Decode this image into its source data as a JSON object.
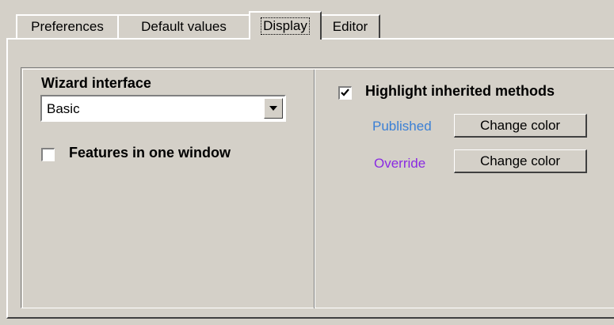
{
  "tabs": [
    {
      "label": "Preferences"
    },
    {
      "label": "Default values"
    },
    {
      "label": "Display",
      "active": true
    },
    {
      "label": "Editor"
    }
  ],
  "left": {
    "wizard_label": "Wizard interface",
    "wizard_value": "Basic",
    "features_label": "Features in one window",
    "features_checked": false
  },
  "right": {
    "highlight_label": "Highlight inherited methods",
    "highlight_checked": true,
    "published_label": "Published",
    "published_color": "#3a7fd5",
    "published_button": "Change color",
    "override_label": "Override",
    "override_color": "#8a2be2",
    "override_button": "Change color"
  }
}
